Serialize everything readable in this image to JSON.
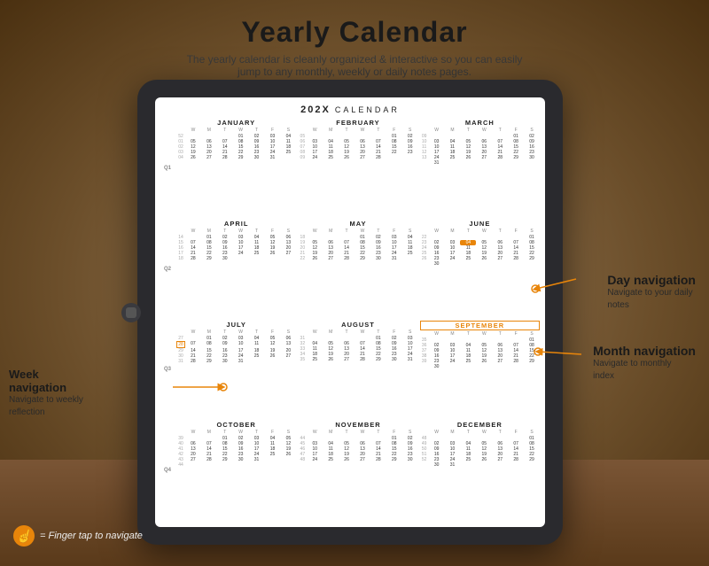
{
  "page": {
    "title": "Yearly Calendar",
    "subtitle": "The yearly calendar is cleanly organized & interactive so you can easily\njump to any monthly, weekly or daily notes pages.",
    "background_color": "#8B6F47"
  },
  "calendar": {
    "header": "202X CALENDAR",
    "months": [
      {
        "name": "JANUARY",
        "highlighted": false
      },
      {
        "name": "FEBRUARY",
        "highlighted": false
      },
      {
        "name": "MARCH",
        "highlighted": false
      },
      {
        "name": "APRIL",
        "highlighted": false
      },
      {
        "name": "MAY",
        "highlighted": false
      },
      {
        "name": "JUNE",
        "highlighted": false
      },
      {
        "name": "JULY",
        "highlighted": false
      },
      {
        "name": "AUGUST",
        "highlighted": false
      },
      {
        "name": "SEPTEMBER",
        "highlighted": true
      },
      {
        "name": "OCTOBER",
        "highlighted": false
      },
      {
        "name": "NOVEMBER",
        "highlighted": false
      },
      {
        "name": "DECEMBER",
        "highlighted": false
      }
    ]
  },
  "annotations": {
    "day_navigation": {
      "title": "Day navigation",
      "subtitle": "Navigate to your daily\nnotes"
    },
    "month_navigation": {
      "title": "Month navigation",
      "subtitle": "Navigate to monthly\nindex"
    },
    "week_navigation": {
      "title": "Week\nnavigation",
      "subtitle": "Navigate to weekly\nreflection"
    }
  },
  "finger_tip": {
    "label": "= Finger tap\nto navigate"
  }
}
